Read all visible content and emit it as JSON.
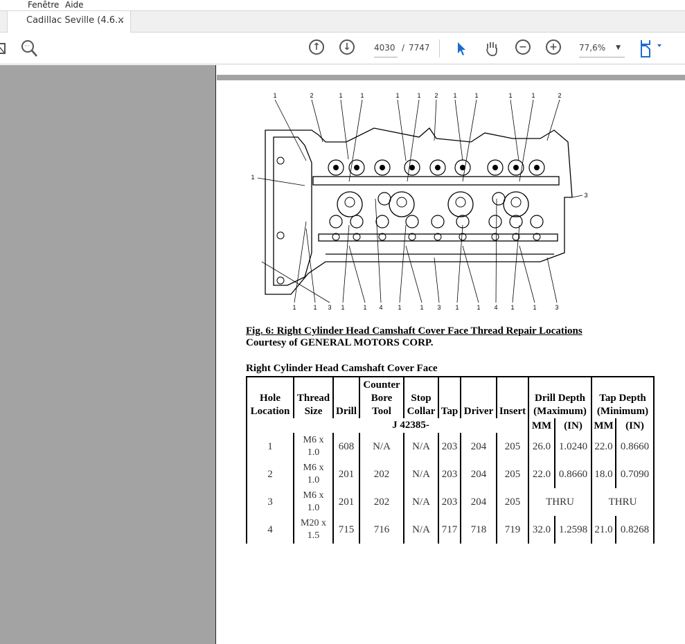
{
  "menubar": {
    "items": [
      "Fenêtre",
      "Aide"
    ]
  },
  "tab": {
    "title": "Cadillac Seville (4.6...",
    "close": "×"
  },
  "toolbar": {
    "page_current": "4030",
    "page_sep": "/",
    "page_total": "7747",
    "zoom": "77,6%",
    "icons": [
      "mail-icon",
      "zoom-search-icon",
      "page-up-icon",
      "page-down-icon",
      "select-arrow-icon",
      "hand-icon",
      "zoom-out-icon",
      "zoom-in-icon",
      "fit-page-icon"
    ]
  },
  "diagram": {
    "top_labels": [
      "1",
      "2",
      "1",
      "1",
      "1",
      "1",
      "2",
      "1",
      "1",
      "1",
      "1",
      "2"
    ],
    "left_label": "1",
    "right_label": "3",
    "bottom_labels": [
      "1",
      "1",
      "3",
      "1",
      "1",
      "4",
      "1",
      "1",
      "3",
      "1",
      "1",
      "4",
      "1",
      "1",
      "3"
    ]
  },
  "caption": {
    "title": "Fig. 6: Right Cylinder Head Camshaft Cover Face Thread Repair Locations",
    "courtesy": "Courtesy of GENERAL MOTORS CORP."
  },
  "table": {
    "title": "Right Cylinder Head Camshaft Cover Face",
    "headers": {
      "hole": [
        "Hole",
        "Location"
      ],
      "thread": [
        "Thread",
        "Size"
      ],
      "drill": "Drill",
      "counter": [
        "Counter",
        "Bore",
        "Tool"
      ],
      "stop": [
        "Stop",
        "Collar"
      ],
      "tap": "Tap",
      "driver": "Driver",
      "insert": "Insert",
      "drill_depth": [
        "Drill Depth",
        "(Maximum)"
      ],
      "tap_depth": [
        "Tap Depth",
        "(Minimum)"
      ]
    },
    "subheader": {
      "tool_prefix": "J 42385-",
      "mm": "MM",
      "in": "(IN)"
    },
    "rows": [
      {
        "hole": "1",
        "thread": [
          "M6 x",
          "1.0"
        ],
        "drill": "608",
        "counter": "N/A",
        "stop": "N/A",
        "tap": "203",
        "driver": "204",
        "insert": "205",
        "dd_mm": "26.0",
        "dd_in": "1.0240",
        "td_mm": "22.0",
        "td_in": "0.8660"
      },
      {
        "hole": "2",
        "thread": [
          "M6 x",
          "1.0"
        ],
        "drill": "201",
        "counter": "202",
        "stop": "N/A",
        "tap": "203",
        "driver": "204",
        "insert": "205",
        "dd_mm": "22.0",
        "dd_in": "0.8660",
        "td_mm": "18.0",
        "td_in": "0.7090"
      },
      {
        "hole": "3",
        "thread": [
          "M6 x",
          "1.0"
        ],
        "drill": "201",
        "counter": "202",
        "stop": "N/A",
        "tap": "203",
        "driver": "204",
        "insert": "205",
        "dd": "THRU",
        "td": "THRU"
      },
      {
        "hole": "4",
        "thread": [
          "M20 x",
          "1.5"
        ],
        "drill": "715",
        "counter": "716",
        "stop": "N/A",
        "tap": "717",
        "driver": "718",
        "insert": "719",
        "dd_mm": "32.0",
        "dd_in": "1.2598",
        "td_mm": "21.0",
        "td_in": "0.8268"
      }
    ]
  }
}
